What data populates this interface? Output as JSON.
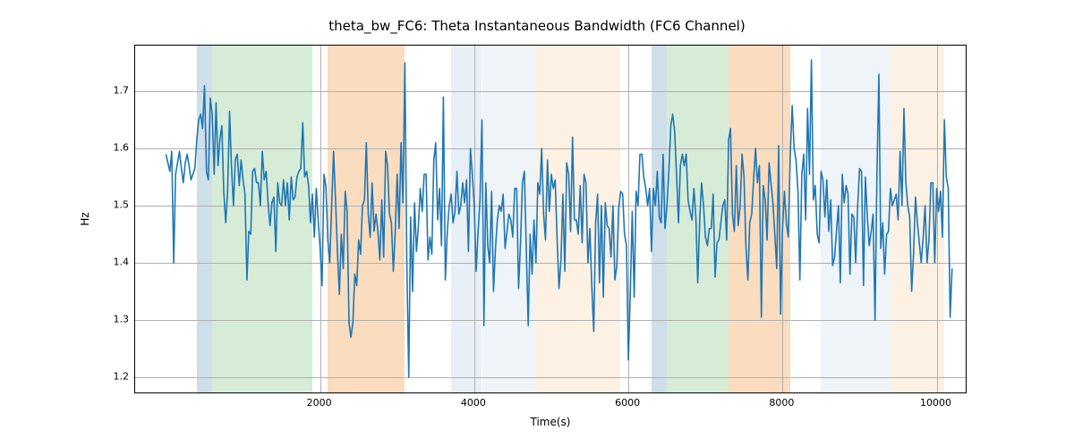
{
  "chart_data": {
    "type": "line",
    "title": "theta_bw_FC6: Theta Instantaneous Bandwidth (FC6 Channel)",
    "xlabel": "Time(s)",
    "ylabel": "Hz",
    "xlim": [
      -400,
      10400
    ],
    "ylim": [
      1.17,
      1.78
    ],
    "xticks": [
      2000,
      4000,
      6000,
      8000,
      10000
    ],
    "yticks": [
      1.2,
      1.3,
      1.4,
      1.5,
      1.6,
      1.7
    ],
    "bands": [
      {
        "x0": 400,
        "x1": 600,
        "color": "#a7c4d8",
        "alpha": 0.55
      },
      {
        "x0": 600,
        "x1": 1900,
        "color": "#b5dcb6",
        "alpha": 0.55
      },
      {
        "x0": 2100,
        "x1": 3100,
        "color": "#f6c08a",
        "alpha": 0.55
      },
      {
        "x0": 3700,
        "x1": 4100,
        "color": "#c7d8ea",
        "alpha": 0.4
      },
      {
        "x0": 4100,
        "x1": 4800,
        "color": "#d2e0ef",
        "alpha": 0.35
      },
      {
        "x0": 4800,
        "x1": 5900,
        "color": "#f9dbbb",
        "alpha": 0.4
      },
      {
        "x0": 6300,
        "x1": 6500,
        "color": "#a7c4d8",
        "alpha": 0.55
      },
      {
        "x0": 6500,
        "x1": 7300,
        "color": "#b5dcb6",
        "alpha": 0.55
      },
      {
        "x0": 7300,
        "x1": 8100,
        "color": "#f6c08a",
        "alpha": 0.55
      },
      {
        "x0": 8500,
        "x1": 9400,
        "color": "#d2e0ef",
        "alpha": 0.35
      },
      {
        "x0": 9400,
        "x1": 10100,
        "color": "#f9dbbb",
        "alpha": 0.4
      }
    ],
    "series": [
      {
        "name": "theta_bw_FC6",
        "color": "#1f77b4",
        "x_start": 0,
        "x_step": 25,
        "y": [
          1.59,
          1.575,
          1.56,
          1.595,
          1.4,
          1.555,
          1.575,
          1.595,
          1.565,
          1.54,
          1.575,
          1.59,
          1.57,
          1.545,
          1.555,
          1.565,
          1.615,
          1.65,
          1.66,
          1.635,
          1.71,
          1.56,
          1.545,
          1.688,
          1.66,
          1.555,
          1.68,
          1.57,
          1.615,
          1.64,
          1.525,
          1.47,
          1.525,
          1.665,
          1.57,
          1.5,
          1.58,
          1.59,
          1.535,
          1.58,
          1.545,
          1.52,
          1.37,
          1.455,
          1.45,
          1.56,
          1.565,
          1.54,
          1.54,
          1.5,
          1.595,
          1.545,
          1.56,
          1.505,
          1.465,
          1.505,
          1.515,
          1.42,
          1.54,
          1.505,
          1.5,
          1.545,
          1.5,
          1.54,
          1.475,
          1.55,
          1.51,
          1.515,
          1.55,
          1.56,
          1.565,
          1.645,
          1.55,
          1.56,
          1.535,
          1.47,
          1.52,
          1.445,
          1.53,
          1.475,
          1.425,
          1.36,
          1.555,
          1.535,
          1.44,
          1.4,
          1.5,
          1.595,
          1.51,
          1.42,
          1.345,
          1.45,
          1.39,
          1.525,
          1.49,
          1.295,
          1.27,
          1.295,
          1.38,
          1.36,
          1.44,
          1.415,
          1.5,
          1.51,
          1.61,
          1.485,
          1.445,
          1.54,
          1.455,
          1.485,
          1.455,
          1.405,
          1.51,
          1.41,
          1.595,
          1.57,
          1.485,
          1.47,
          1.385,
          1.455,
          1.555,
          1.46,
          1.61,
          1.505,
          1.75,
          1.405,
          1.2,
          1.48,
          1.35,
          1.505,
          1.42,
          1.465,
          1.53,
          1.49,
          1.555,
          1.555,
          1.405,
          1.445,
          1.415,
          1.58,
          1.61,
          1.475,
          1.53,
          1.43,
          1.69,
          1.37,
          1.455,
          1.5,
          1.52,
          1.47,
          1.49,
          1.56,
          1.485,
          1.5,
          1.54,
          1.505,
          1.545,
          1.42,
          1.6,
          1.555,
          1.5,
          1.385,
          1.455,
          1.51,
          1.65,
          1.29,
          1.54,
          1.43,
          1.4,
          1.525,
          1.35,
          1.425,
          1.475,
          1.5,
          1.49,
          1.52,
          1.425,
          1.455,
          1.485,
          1.475,
          1.445,
          1.53,
          1.53,
          1.355,
          1.435,
          1.54,
          1.56,
          1.425,
          1.29,
          1.45,
          1.38,
          1.475,
          1.4,
          1.54,
          1.52,
          1.6,
          1.485,
          1.44,
          1.58,
          1.49,
          1.555,
          1.53,
          1.545,
          1.44,
          1.355,
          1.405,
          1.52,
          1.385,
          1.575,
          1.555,
          1.455,
          1.62,
          1.475,
          1.475,
          1.45,
          1.535,
          1.435,
          1.555,
          1.54,
          1.4,
          1.46,
          1.36,
          1.28,
          1.47,
          1.52,
          1.365,
          1.5,
          1.34,
          1.505,
          1.465,
          1.46,
          1.41,
          1.5,
          1.37,
          1.395,
          1.495,
          1.525,
          1.52,
          1.45,
          1.43,
          1.23,
          1.35,
          1.49,
          1.34,
          1.525,
          1.5,
          1.59,
          1.59,
          1.55,
          1.53,
          1.5,
          1.53,
          1.42,
          1.53,
          1.5,
          1.56,
          1.48,
          1.47,
          1.59,
          1.46,
          1.5,
          1.56,
          1.64,
          1.66,
          1.63,
          1.555,
          1.47,
          1.57,
          1.59,
          1.57,
          1.59,
          1.51,
          1.49,
          1.475,
          1.53,
          1.48,
          1.365,
          1.475,
          1.54,
          1.5,
          1.445,
          1.43,
          1.46,
          1.46,
          1.52,
          1.375,
          1.435,
          1.44,
          1.47,
          1.5,
          1.51,
          1.44,
          1.615,
          1.635,
          1.485,
          1.455,
          1.57,
          1.465,
          1.5,
          1.59,
          1.55,
          1.43,
          1.37,
          1.47,
          1.485,
          1.545,
          1.6,
          1.54,
          1.57,
          1.305,
          1.535,
          1.51,
          1.44,
          1.575,
          1.54,
          1.505,
          1.45,
          1.39,
          1.605,
          1.31,
          1.46,
          1.525,
          1.47,
          1.445,
          1.585,
          1.675,
          1.6,
          1.58,
          1.525,
          1.37,
          1.555,
          1.59,
          1.475,
          1.67,
          1.555,
          1.755,
          1.51,
          1.535,
          1.45,
          1.435,
          1.56,
          1.545,
          1.48,
          1.545,
          1.455,
          1.51,
          1.395,
          1.41,
          1.455,
          1.5,
          1.365,
          1.555,
          1.505,
          1.535,
          1.52,
          1.38,
          1.485,
          1.48,
          1.4,
          1.5,
          1.565,
          1.56,
          1.36,
          1.55,
          1.48,
          1.43,
          1.455,
          1.485,
          1.3,
          1.555,
          1.73,
          1.425,
          1.47,
          1.38,
          1.45,
          1.455,
          1.53,
          1.5,
          1.51,
          1.52,
          1.475,
          1.595,
          1.5,
          1.67,
          1.54,
          1.5,
          1.48,
          1.35,
          1.415,
          1.515,
          1.47,
          1.435,
          1.4,
          1.445,
          1.5,
          1.4,
          1.44,
          1.54,
          1.54,
          1.4,
          1.53,
          1.49,
          1.525,
          1.445,
          1.65,
          1.55,
          1.53,
          1.305,
          1.39
        ]
      }
    ]
  }
}
